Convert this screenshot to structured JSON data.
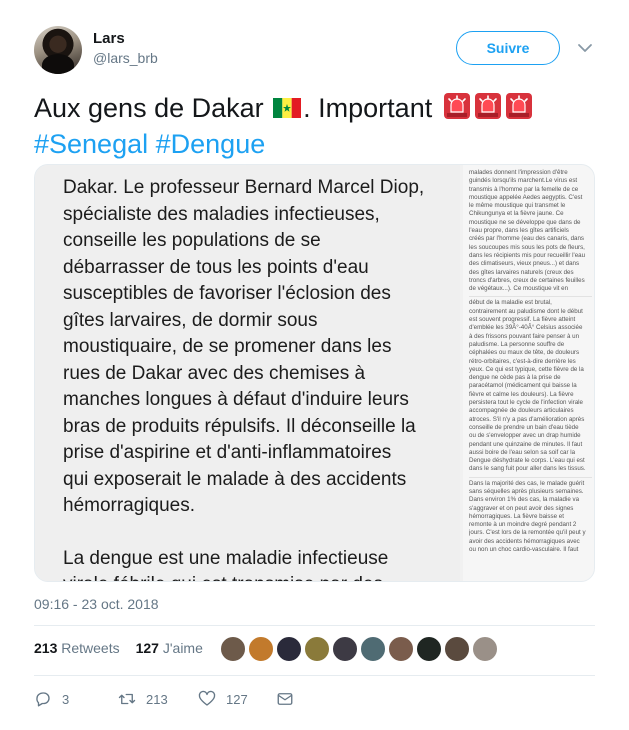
{
  "author": {
    "display_name": "Lars",
    "handle": "@lars_brb",
    "follow_label": "Suivre"
  },
  "tweet": {
    "line1_prefix": "Aux gens de Dakar",
    "line1_suffix": ". Important",
    "hashtags": [
      "#Senegal",
      "#Dengue"
    ],
    "emoji": [
      "flag-senegal",
      "police-light",
      "police-light",
      "police-light"
    ]
  },
  "media": {
    "main_paragraphs": [
      [
        "Dakar. Le professeur Bernard Marcel Diop,",
        "spécialiste des maladies infectieuses,",
        "conseille les populations de se",
        "débarrasser de tous les points d'eau",
        "susceptibles de favoriser l'éclosion des",
        "gîtes larvaires, de dormir sous",
        "moustiquaire, de se promener dans les",
        "rues de Dakar avec des chemises à",
        "manches longues à défaut d'induire leurs",
        "bras de produits répulsifs. Il déconseille la",
        "prise d'aspirine et d'anti-inflammatoires",
        "qui exposerait le malade à des accidents",
        "hémorragiques."
      ],
      [
        "La dengue est une maladie infectieuse",
        "virale fébrile qui est transmise par des"
      ]
    ],
    "side_blocks": [
      [
        "malades donnent l'impression d'être",
        "guindés lorsqu'ils marchent.Le virus est",
        "transmis à l'homme par la femelle de ce",
        "moustique appelée Aedes aegyptis. C'est",
        "le même moustique qui transmet le",
        "Chikungunya et la fièvre jaune. Ce",
        "moustique ne se développe que dans de",
        "l'eau propre, dans les gîtes artificiels",
        "créés par l'homme (eau des canaris, dans",
        "les soucoupes mis sous les pots de fleurs,",
        "dans les récipients mis pour recueillir l'eau",
        "des climatiseurs, vieux pneus...) et dans",
        "des gîtes larvaires naturels (creux des",
        "troncs d'arbres, creux de certaines feuilles",
        "de végétaux...). Ce moustique vit en"
      ],
      [
        "début de la maladie est brutal,",
        "contrairement au paludisme dont le début",
        "est souvent progressif. La fièvre atteint",
        "d'emblée les 39Â°-40Â° Celsius associée",
        "à des frissons pouvant faire penser à un",
        "paludisme. La personne souffre de",
        "céphalées ou maux de tête, de douleurs",
        "rétro-orbitaires, c'est-à-dire derrière les",
        "yeux. Ce qui est typique, cette fièvre de la",
        "dengue ne cède pas à la prise de",
        "paracétamol (médicament qui baisse la",
        "fièvre et calme les douleurs). La fièvre",
        "persistera tout le cycle de l'infection virale",
        "accompagnée de douleurs articulaires",
        "atroces. S'il n'y a pas d'amélioration après",
        "conseille de prendre un bain d'eau tiède",
        "ou de s'envelopper avec un drap humide",
        "pendant une quinzaine de minutes. Il faut",
        "aussi boire de l'eau selon sa soif car la",
        "Dengue déshydrate le corps. L'eau qui est",
        "dans le sang fuit pour aller dans les tissus."
      ],
      [
        "Dans la majorité des cas, le malade guérit",
        "sans séquelles après plusieurs semaines.",
        "Dans environ 1% des cas, la maladie va",
        "s'aggraver et on peut avoir des signes",
        "hémorragiques. La fièvre baisse et",
        "remonte à un moindre degré pendant 2",
        "jours. C'est lors de la remontée qu'il peut y",
        "avoir des accidents hémorragiques avec",
        "ou non un choc cardio-vasculaire. Il faut"
      ]
    ]
  },
  "timestamp": "09:16 - 23 oct. 2018",
  "stats": {
    "retweets_count": "213",
    "retweets_label": "Retweets",
    "likes_count": "127",
    "likes_label": "J'aime"
  },
  "likers": [
    {
      "name": "liker-1",
      "color": "#6d5a4a"
    },
    {
      "name": "liker-2",
      "color": "#c27a2c"
    },
    {
      "name": "liker-3",
      "color": "#2a2a3a"
    },
    {
      "name": "liker-4",
      "color": "#8a7a3a"
    },
    {
      "name": "liker-5",
      "color": "#3d3a44"
    },
    {
      "name": "liker-6",
      "color": "#4f6b73"
    },
    {
      "name": "liker-7",
      "color": "#7a5c4c"
    },
    {
      "name": "liker-8",
      "color": "#1f2622"
    },
    {
      "name": "liker-9",
      "color": "#5a4a3e"
    },
    {
      "name": "liker-10",
      "color": "#9a9088"
    }
  ],
  "actions": {
    "reply_count": "3",
    "retweet_count": "213",
    "like_count": "127"
  },
  "colors": {
    "accent": "#1da1f2",
    "muted": "#657786",
    "text": "#14171a"
  }
}
